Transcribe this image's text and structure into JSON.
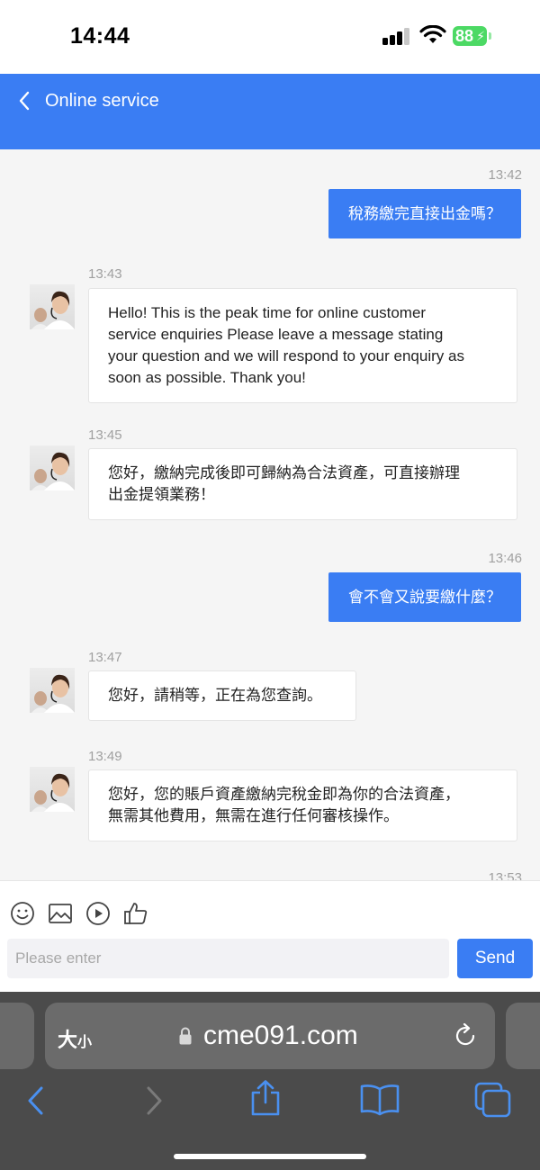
{
  "status_bar": {
    "time": "14:44",
    "battery": "88"
  },
  "header": {
    "title": "Online service"
  },
  "messages": [
    {
      "side": "out",
      "time": "13:42",
      "text": "稅務繳完直接出金嗎？"
    },
    {
      "side": "in",
      "time": "13:43",
      "lines": [
        "Hello! This is the peak time for online customer",
        "service enquiries Please leave a message stating",
        "your question and we will respond to your enquiry as",
        "soon as possible. Thank you!"
      ]
    },
    {
      "side": "in",
      "time": "13:45",
      "lines": [
        "您好，繳納完成後即可歸納為合法資產，可直接辦理",
        "出金提領業務！"
      ]
    },
    {
      "side": "out",
      "time": "13:46",
      "text": "會不會又說要繳什麼？"
    },
    {
      "side": "in",
      "time": "13:47",
      "lines": [
        "您好，請稍等，正在為您查詢。"
      ]
    },
    {
      "side": "in",
      "time": "13:49",
      "lines": [
        "您好，您的賬戶資產繳納完稅金即為你的合法資產，",
        "無需其他費用，無需在進行任何審核操作。"
      ]
    },
    {
      "side": "out",
      "time": "13:53"
    }
  ],
  "input": {
    "placeholder": "Please enter",
    "value": "",
    "send_label": "Send"
  },
  "toolbar_icons": [
    "emoji-icon",
    "image-icon",
    "video-icon",
    "thumbs-up-icon"
  ],
  "browser": {
    "text_size_big": "大",
    "text_size_small": "小",
    "url": "cme091.com"
  },
  "colors": {
    "accent": "#3a7df3",
    "battery": "#4cd964",
    "browser_bg": "#4b4b4b"
  }
}
